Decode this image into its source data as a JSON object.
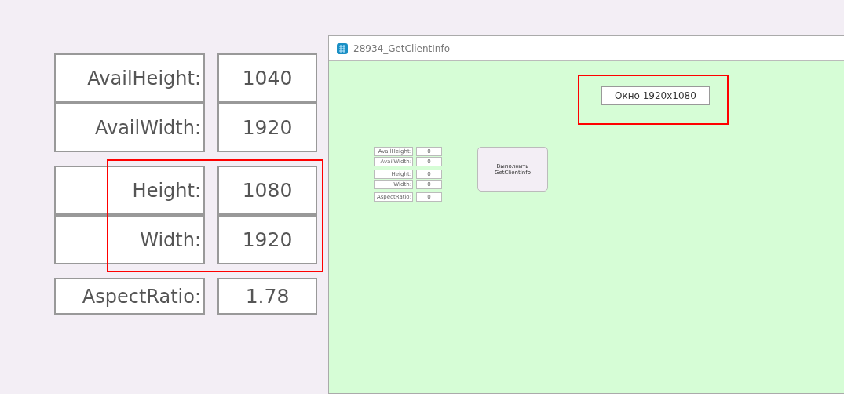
{
  "info_panel": {
    "groups": [
      {
        "highlighted": false,
        "rows": [
          {
            "label": "AvailHeight:",
            "value": "1040"
          },
          {
            "label": "AvailWidth:",
            "value": "1920"
          }
        ]
      },
      {
        "highlighted": true,
        "rows": [
          {
            "label": "Height:",
            "value": "1080"
          },
          {
            "label": "Width:",
            "value": "1920"
          }
        ]
      },
      {
        "highlighted": false,
        "rows": [
          {
            "label": "AspectRatio:",
            "value": "1.78"
          }
        ]
      }
    ]
  },
  "window": {
    "title": "28934_GetClientInfo",
    "caption": {
      "text": "Окно 1920x1080",
      "highlighted": true
    },
    "groups": [
      {
        "rows": [
          {
            "label": "AvailHeight:",
            "value": "0"
          },
          {
            "label": "AvailWidth:",
            "value": "0"
          }
        ]
      },
      {
        "rows": [
          {
            "label": "Height:",
            "value": "0"
          },
          {
            "label": "Width:",
            "value": "0"
          }
        ]
      },
      {
        "rows": [
          {
            "label": "AspectRatio:",
            "value": "0"
          }
        ]
      }
    ],
    "button": "Выполнить GetClientInfo"
  }
}
